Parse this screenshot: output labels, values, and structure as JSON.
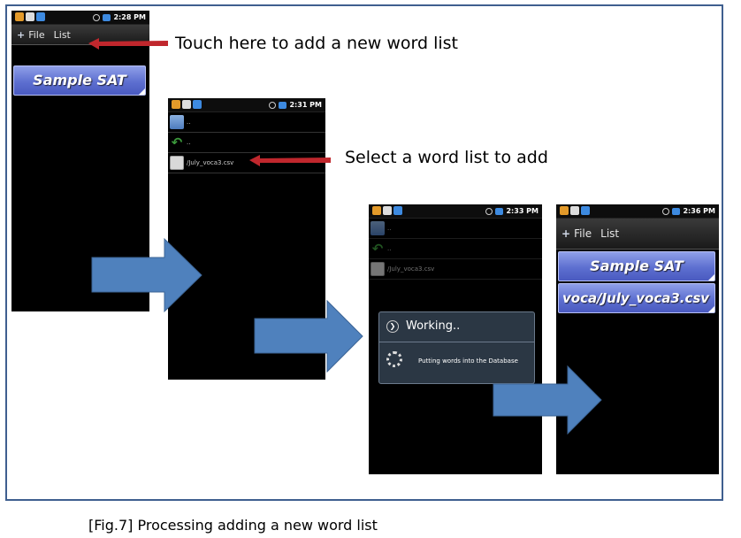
{
  "colors": {
    "frame_border": "#3f5f8f",
    "arrow_blue": "#4f81bd",
    "pointer_red": "#c0272d",
    "list_item": "#5d6fd0"
  },
  "annotations": {
    "touch_label": "Touch here to add a new word list",
    "select_label": "Select a word list to add"
  },
  "caption": "[Fig.7] Processing adding a new word list",
  "screens": [
    {
      "time": "2:28 PM",
      "menu": {
        "file": "File",
        "list": "List"
      },
      "lists": [
        "Sample SAT"
      ]
    },
    {
      "time": "2:31 PM",
      "files": [
        "..",
        "..",
        "/July_voca3.csv"
      ]
    },
    {
      "time": "2:33 PM",
      "files": [
        "..",
        "..",
        "/July_voca3.csv"
      ],
      "dialog": {
        "title": "Working..",
        "message": "Putting words into the Database"
      }
    },
    {
      "time": "2:36 PM",
      "menu": {
        "file": "File",
        "list": "List"
      },
      "lists": [
        "Sample SAT",
        "voca/July_voca3.csv"
      ]
    }
  ]
}
